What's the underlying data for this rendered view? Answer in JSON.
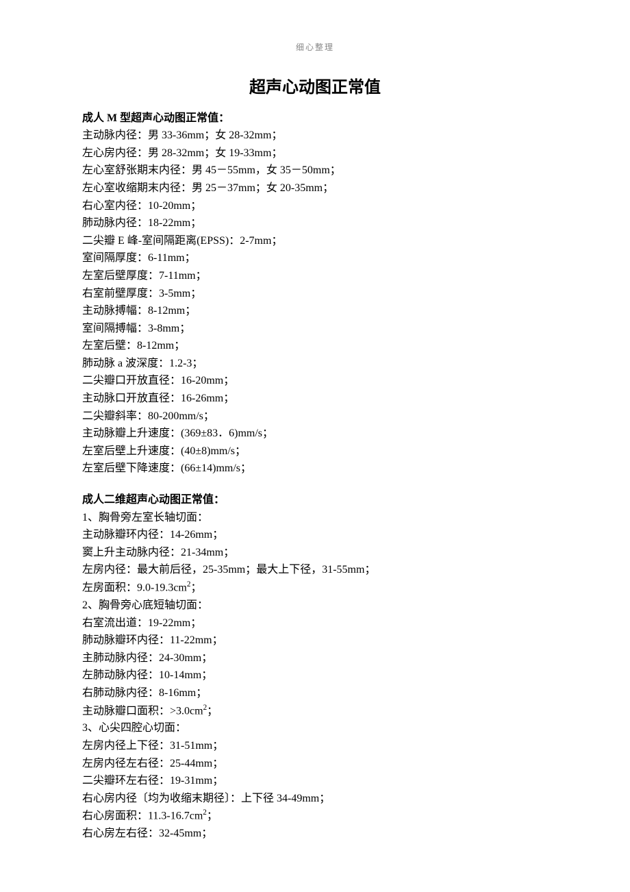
{
  "header": "细心整理",
  "title": "超声心动图正常值",
  "section1": {
    "title": "成人 M 型超声心动图正常值：",
    "lines": [
      "主动脉内径：男 33-36mm；女 28-32mm；",
      "左心房内径：男 28-32mm；女 19-33mm；",
      "左心室舒张期末内径：男 45－55mm，女 35－50mm；",
      "左心室收缩期末内径：男 25－37mm；女 20-35mm；",
      "右心室内径：10-20mm；",
      "肺动脉内径：18-22mm；",
      "二尖瓣 E 峰-室间隔距离(EPSS)：2-7mm；",
      "室间隔厚度：6-11mm；",
      "左室后壁厚度：7-11mm；",
      "右室前壁厚度：3-5mm；",
      "主动脉搏幅：8-12mm；",
      "室间隔搏幅：3-8mm；",
      "左室后壁：8-12mm；",
      "肺动脉 a 波深度：1.2-3；",
      "二尖瓣口开放直径：16-20mm；",
      "主动脉口开放直径：16-26mm；",
      "二尖瓣斜率：80-200mm/s；",
      "主动脉瓣上升速度：(369±83．6)mm/s；",
      "左室后壁上升速度：(40±8)mm/s；",
      "左室后壁下降速度：(66±14)mm/s；"
    ]
  },
  "section2": {
    "title": "成人二维超声心动图正常值：",
    "lines": [
      "1、胸骨旁左室长轴切面：",
      "主动脉瓣环内径：14-26mm；",
      "窦上升主动脉内径：21-34mm；",
      "左房内径：最大前后径，25-35mm；最大上下径，31-55mm；",
      "左房面积：9.0-19.3cm²；",
      "2、胸骨旁心底短轴切面：",
      "右室流出道：19-22mm；",
      "肺动脉瓣环内径：11-22mm；",
      "主肺动脉内径：24-30mm；",
      "左肺动脉内径：10-14mm；",
      "右肺动脉内径：8-16mm；",
      "主动脉瓣口面积：>3.0cm²；",
      "3、心尖四腔心切面：",
      "左房内径上下径：31-51mm；",
      "左房内径左右径：25-44mm；",
      "二尖瓣环左右径：19-31mm；",
      "右心房内径〔均为收缩末期径〕：上下径 34-49mm；",
      "右心房面积：11.3-16.7cm²；",
      "右心房左右径：32-45mm；"
    ]
  }
}
